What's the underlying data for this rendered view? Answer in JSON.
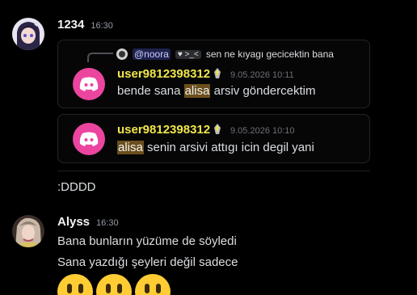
{
  "messages": {
    "first": {
      "author": "1234",
      "time": "16:30",
      "reply": {
        "mention": "@noora",
        "tag": "♥ >_<",
        "text": "sen ne kıyagı gecicektin bana"
      },
      "card1": {
        "name": "user9812398312",
        "date": "9.05.2026 10:11",
        "pre": "bende sana ",
        "highlight": "alisa",
        "post": " arsiv göndercektim"
      },
      "card2": {
        "name": "user9812398312",
        "date": "9.05.2026 10:10",
        "pre": "",
        "highlight": "alisa",
        "post": " senin arsivi attıgı icin degil yani"
      },
      "followup": ":DDDD"
    },
    "second": {
      "author": "Alyss",
      "time": "16:30",
      "line1": "Bana bunların yüzüme de söyledi",
      "line2": "Sana yazdığı şeyleri değil sadece",
      "emoji_count": "3"
    }
  },
  "colors": {
    "background": "#000000",
    "name_highlight": "#f0e64a",
    "discord_avatar": "#eb459f",
    "keyword_highlight": "#6b4f1c"
  }
}
